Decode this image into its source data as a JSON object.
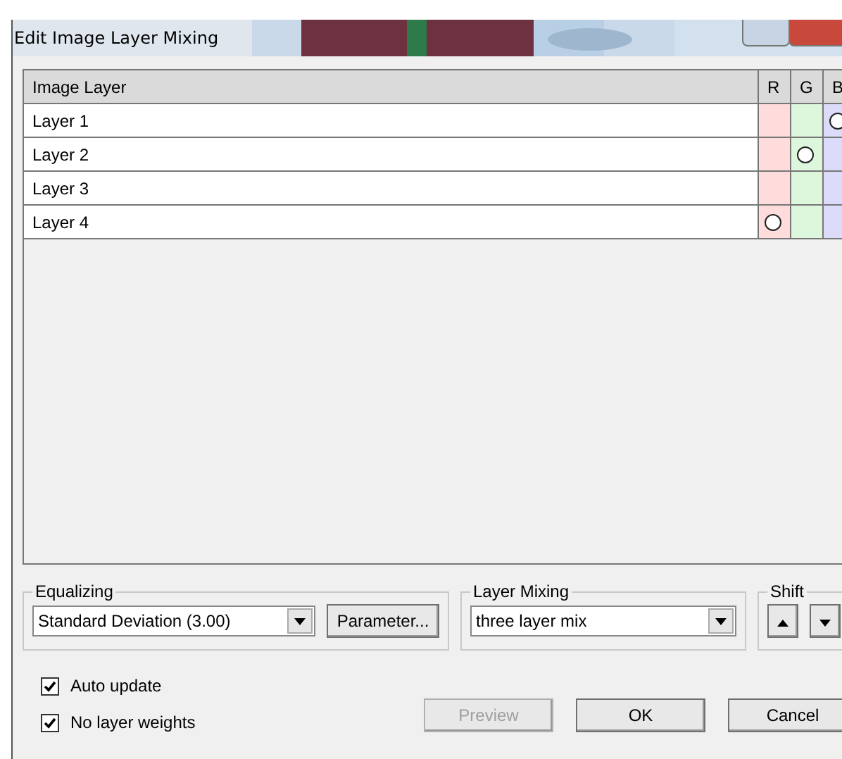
{
  "window": {
    "title": "Edit Image Layer Mixing"
  },
  "table": {
    "columns": [
      "Image Layer",
      "R",
      "G",
      "B"
    ],
    "rows": [
      {
        "name": "Layer 1",
        "r": false,
        "g": false,
        "b": true
      },
      {
        "name": "Layer 2",
        "r": false,
        "g": true,
        "b": false
      },
      {
        "name": "Layer 3",
        "r": false,
        "g": false,
        "b": false
      },
      {
        "name": "Layer 4",
        "r": true,
        "g": false,
        "b": false
      }
    ]
  },
  "equalizing": {
    "label": "Equalizing",
    "value": "Standard Deviation (3.00)",
    "button": "Parameter..."
  },
  "layer_mixing": {
    "label": "Layer Mixing",
    "value": "three layer mix"
  },
  "shift": {
    "label": "Shift"
  },
  "checkboxes": [
    {
      "label": "Auto update",
      "checked": true
    },
    {
      "label": "No layer weights",
      "checked": true
    }
  ],
  "buttons": [
    {
      "label": "Preview",
      "disabled": true
    },
    {
      "label": "OK",
      "disabled": false
    },
    {
      "label": "Cancel",
      "disabled": false
    }
  ]
}
